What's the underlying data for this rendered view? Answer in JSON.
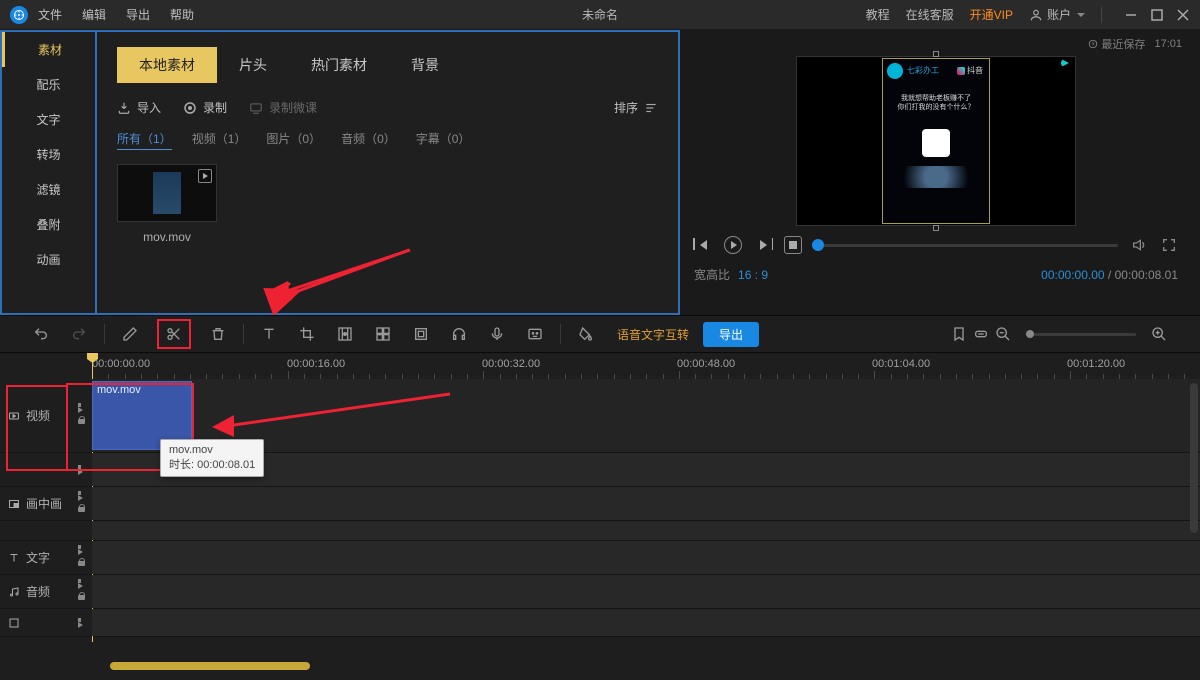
{
  "titlebar": {
    "menu": [
      "文件",
      "编辑",
      "导出",
      "帮助"
    ],
    "title": "未命名",
    "right": {
      "tutorial": "教程",
      "service": "在线客服",
      "vip": "开通VIP",
      "account": "账户"
    },
    "save_label": "最近保存",
    "save_time": "17:01"
  },
  "sidebar": {
    "items": [
      "素材",
      "配乐",
      "文字",
      "转场",
      "滤镜",
      "叠附",
      "动画"
    ],
    "active_index": 0
  },
  "media": {
    "tabs": [
      "本地素材",
      "片头",
      "热门素材",
      "背景"
    ],
    "active_tab": 0,
    "import_actions": {
      "import": "导入",
      "record": "录制",
      "lesson": "录制微课"
    },
    "sort_label": "排序",
    "filters": {
      "all": "所有（1）",
      "video": "视频（1）",
      "image": "图片（0）",
      "audio": "音频（0）",
      "subtitle": "字幕（0）"
    },
    "thumb_name": "mov.mov"
  },
  "preview": {
    "caption_l1": "我就想帮助老板赚不了",
    "caption_l2": "你们打我的没有个什么？",
    "aspect_label": "宽高比",
    "aspect_value": "16 : 9",
    "tc_current": "00:00:00.00",
    "tc_total": "00:00:08.01"
  },
  "toolbar": {
    "voice_convert": "语音文字互转",
    "export": "导出"
  },
  "timeline": {
    "ruler": [
      "00:00:00.00",
      "00:00:16.00",
      "00:00:32.00",
      "00:00:48.00",
      "00:01:04.00",
      "00:01:20.00"
    ],
    "tracks": {
      "video": "视频",
      "pip": "画中画",
      "text": "文字",
      "audio": "音频"
    },
    "clip_name": "mov.mov",
    "tooltip_name": "mov.mov",
    "tooltip_dur_label": "时长: ",
    "tooltip_dur": "00:00:08.01"
  }
}
